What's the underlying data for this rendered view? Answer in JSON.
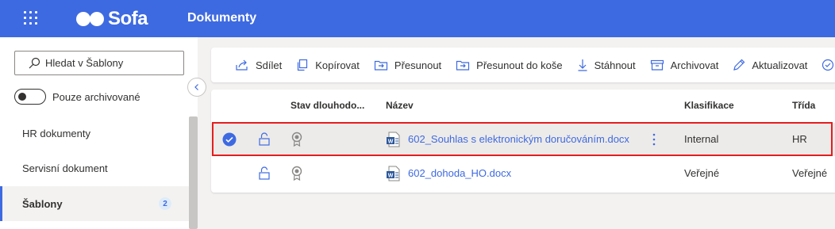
{
  "header": {
    "app_name": "Sofa",
    "title": "Dokumenty",
    "accent": "#3e6ae1"
  },
  "sidebar": {
    "search_placeholder": "Hledat v Šablony",
    "toggle_label": "Pouze archivované",
    "toggle_on": false,
    "items": [
      {
        "label": "HR dokumenty",
        "active": false
      },
      {
        "label": "Servisní dokument",
        "active": false
      },
      {
        "label": "Šablony",
        "active": true,
        "badge": "2"
      }
    ]
  },
  "commands": [
    {
      "label": "Sdílet",
      "icon": "share-icon"
    },
    {
      "label": "Kopírovat",
      "icon": "copy-icon"
    },
    {
      "label": "Přesunout",
      "icon": "move-icon"
    },
    {
      "label": "Přesunout do koše",
      "icon": "move-to-trash-icon"
    },
    {
      "label": "Stáhnout",
      "icon": "download-icon"
    },
    {
      "label": "Archivovat",
      "icon": "archive-icon"
    },
    {
      "label": "Aktualizovat",
      "icon": "edit-icon"
    }
  ],
  "table": {
    "columns": [
      "Stav dlouhodo...",
      "Název",
      "Klasifikace",
      "Třída"
    ],
    "rows": [
      {
        "name": "602_Souhlas s elektronickým doručováním.docx",
        "classification": "Internal",
        "class": "HR",
        "selected": true
      },
      {
        "name": "602_dohoda_HO.docx",
        "classification": "Veřejné",
        "class": "Veřejné",
        "selected": false
      }
    ]
  },
  "highlight_color": "#e41e1e"
}
